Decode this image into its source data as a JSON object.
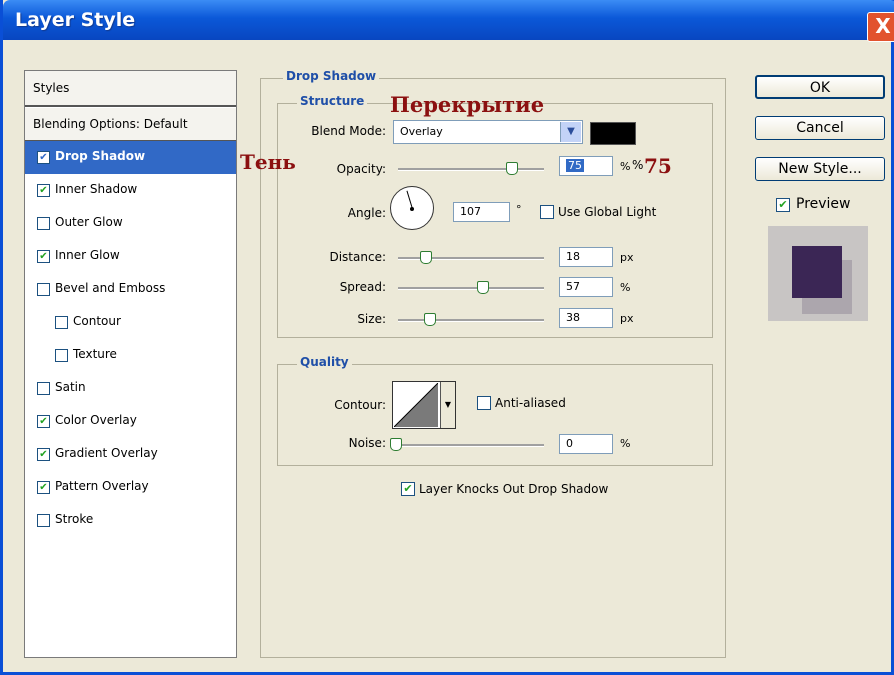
{
  "window": {
    "title": "Layer Style",
    "close_glyph": "X"
  },
  "styles_panel": {
    "header": "Styles",
    "blending_options": "Blending Options: Default",
    "items": [
      {
        "label": "Drop Shadow",
        "checked": true,
        "selected": true,
        "indent": 0
      },
      {
        "label": "Inner Shadow",
        "checked": true,
        "selected": false,
        "indent": 0
      },
      {
        "label": "Outer Glow",
        "checked": false,
        "selected": false,
        "indent": 0
      },
      {
        "label": "Inner Glow",
        "checked": true,
        "selected": false,
        "indent": 0
      },
      {
        "label": "Bevel and Emboss",
        "checked": false,
        "selected": false,
        "indent": 0
      },
      {
        "label": "Contour",
        "checked": false,
        "selected": false,
        "indent": 1
      },
      {
        "label": "Texture",
        "checked": false,
        "selected": false,
        "indent": 1
      },
      {
        "label": "Satin",
        "checked": false,
        "selected": false,
        "indent": 0
      },
      {
        "label": "Color Overlay",
        "checked": true,
        "selected": false,
        "indent": 0
      },
      {
        "label": "Gradient Overlay",
        "checked": true,
        "selected": false,
        "indent": 0
      },
      {
        "label": "Pattern Overlay",
        "checked": true,
        "selected": false,
        "indent": 0
      },
      {
        "label": "Stroke",
        "checked": false,
        "selected": false,
        "indent": 0
      }
    ]
  },
  "drop_shadow": {
    "section_title": "Drop Shadow",
    "structure": {
      "title": "Structure",
      "blend_mode_label": "Blend Mode:",
      "blend_mode_value": "Overlay",
      "shadow_color": "#000000",
      "opacity_label": "Opacity:",
      "opacity_value": "75",
      "opacity_unit": "%",
      "angle_label": "Angle:",
      "angle_value": "107",
      "angle_unit": "°",
      "use_global_light_label": "Use Global Light",
      "use_global_light": false,
      "distance_label": "Distance:",
      "distance_value": "18",
      "distance_unit": "px",
      "spread_label": "Spread:",
      "spread_value": "57",
      "spread_unit": "%",
      "size_label": "Size:",
      "size_value": "38",
      "size_unit": "px"
    },
    "quality": {
      "title": "Quality",
      "contour_label": "Contour:",
      "anti_aliased_label": "Anti-aliased",
      "anti_aliased": false,
      "noise_label": "Noise:",
      "noise_value": "0",
      "noise_unit": "%"
    },
    "knocks_out_label": "Layer Knocks Out Drop Shadow",
    "knocks_out": true
  },
  "buttons": {
    "ok": "OK",
    "cancel": "Cancel",
    "new_style": "New Style...",
    "preview_label": "Preview",
    "preview_checked": true
  },
  "annotations": {
    "overlay_ru": "Перекрытие",
    "shadow_ru": "Тень",
    "opacity_ru": "75"
  },
  "colors": {
    "accent": "#1f4fa8",
    "selection": "#3169c6",
    "annotation": "#8b1010",
    "preview_swatch": "#3b2655"
  }
}
